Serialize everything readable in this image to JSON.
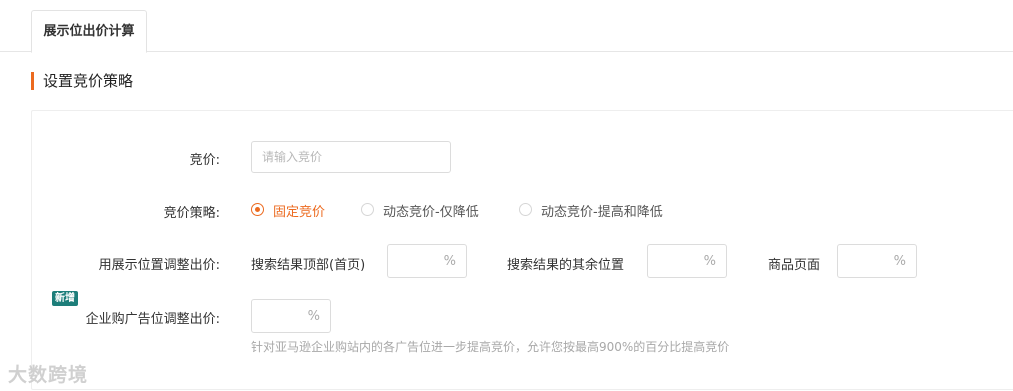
{
  "tabs": [
    {
      "label": "展示位出价计算",
      "active": true
    }
  ],
  "section": {
    "title": "设置竞价策略"
  },
  "bid": {
    "label": "竞价:",
    "placeholder": "请输入竞价",
    "value": ""
  },
  "strategy": {
    "label": "竞价策略:",
    "options": [
      {
        "label": "固定竞价",
        "checked": true
      },
      {
        "label": "动态竞价-仅降低",
        "checked": false
      },
      {
        "label": "动态竞价-提高和降低",
        "checked": false
      }
    ]
  },
  "placement": {
    "label": "用展示位置调整出价:",
    "items": [
      {
        "label": "搜索结果顶部(首页)",
        "unit": "%",
        "value": ""
      },
      {
        "label": "搜索结果的其余位置",
        "unit": "%",
        "value": ""
      },
      {
        "label": "商品页面",
        "unit": "%",
        "value": ""
      }
    ]
  },
  "business": {
    "badge": "新增",
    "label": "企业购广告位调整出价:",
    "unit": "%",
    "value": "",
    "hint": "针对亚马逊企业购站内的各广告位进一步提高竞价，允许您按最高900%的百分比提高竞价"
  },
  "watermark": "大数跨境",
  "colors": {
    "accent": "#ec6a1f",
    "badge": "#1d7e7a"
  }
}
